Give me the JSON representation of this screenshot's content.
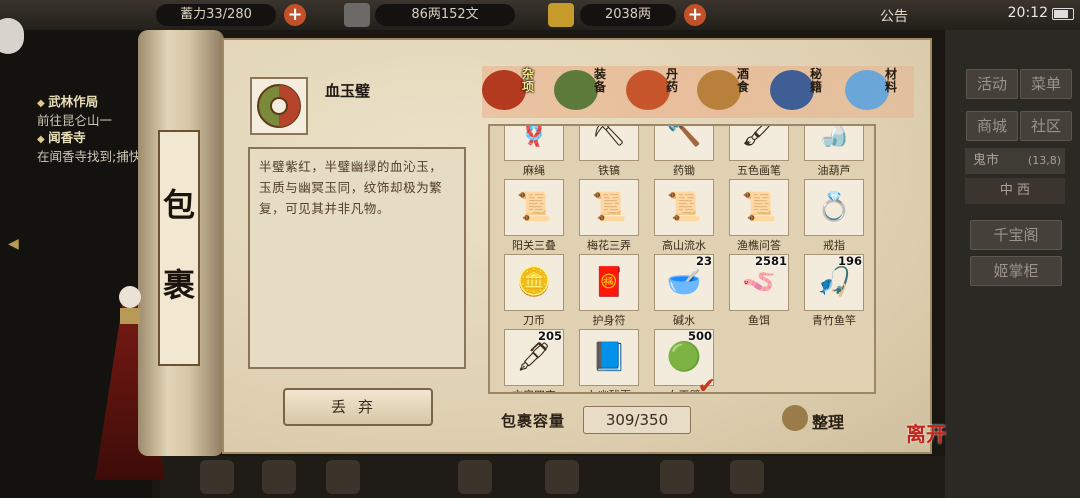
{
  "topbar": {
    "partial_label": "蓄力33/280",
    "money": "86两152文",
    "gold": "2038两",
    "notice": "公告",
    "time": "20:12"
  },
  "quests": [
    {
      "title": "武林作局",
      "desc": "前往昆仑山一"
    },
    {
      "title": "闻香寺",
      "desc": "在闻香寺找到;捕快"
    }
  ],
  "right_panel": {
    "buttons": [
      "活动",
      "菜单",
      "商城",
      "社区"
    ],
    "market": "鬼市",
    "coords": "(13,8)",
    "direction": "中 西",
    "shop1": "千宝阁",
    "shop2": "姬掌柜"
  },
  "scroll_title": [
    "包",
    "裹"
  ],
  "detail": {
    "name": "血玉璧",
    "description": "半璧紫红，半璧幽绿的血沁玉，玉质与幽冥玉同，纹饰却极为繁复，可见其并非凡物。",
    "discard_label": "丢弃"
  },
  "tabs": [
    {
      "label": "杂项",
      "active": true,
      "color": "#b33a1e"
    },
    {
      "label": "装备",
      "active": false,
      "color": "#5e7a3a"
    },
    {
      "label": "丹药",
      "active": false,
      "color": "#c7552c"
    },
    {
      "label": "酒食",
      "active": false,
      "color": "#b8803b"
    },
    {
      "label": "秘籍",
      "active": false,
      "color": "#3f5e96"
    },
    {
      "label": "材料",
      "active": false,
      "color": "#6aa7d8"
    }
  ],
  "items": [
    {
      "name": "麻绳",
      "glyph": "🪢",
      "qty": ""
    },
    {
      "name": "铁镐",
      "glyph": "⛏",
      "qty": ""
    },
    {
      "name": "药锄",
      "glyph": "🔨",
      "qty": ""
    },
    {
      "name": "五色画笔",
      "glyph": "🖌",
      "qty": ""
    },
    {
      "name": "油葫芦",
      "glyph": "🍶",
      "qty": ""
    },
    {
      "name": "阳关三叠",
      "glyph": "📜",
      "qty": ""
    },
    {
      "name": "梅花三弄",
      "glyph": "📜",
      "qty": ""
    },
    {
      "name": "高山流水",
      "glyph": "📜",
      "qty": ""
    },
    {
      "name": "渔樵问答",
      "glyph": "📜",
      "qty": ""
    },
    {
      "name": "戒指",
      "glyph": "💍",
      "qty": ""
    },
    {
      "name": "刀币",
      "glyph": "🪙",
      "qty": ""
    },
    {
      "name": "护身符",
      "glyph": "🧧",
      "qty": ""
    },
    {
      "name": "碱水",
      "glyph": "🥣",
      "qty": "23"
    },
    {
      "name": "鱼饵",
      "glyph": "🪱",
      "qty": "2581"
    },
    {
      "name": "青竹鱼竿",
      "glyph": "🎣",
      "qty": "196"
    },
    {
      "name": "文房四宝",
      "glyph": "🖋",
      "qty": "205"
    },
    {
      "name": "九幽残页",
      "glyph": "📘",
      "qty": ""
    },
    {
      "name": "血玉璧",
      "glyph": "🟢",
      "qty": "500",
      "selected": true
    }
  ],
  "capacity": {
    "label": "包裹容量",
    "value": "309/350"
  },
  "sort_label": "整理",
  "leave_label": "离开"
}
